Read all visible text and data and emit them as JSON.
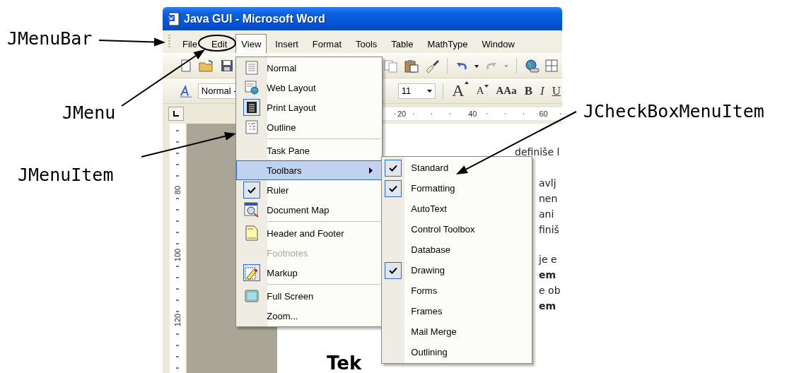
{
  "window": {
    "title": "Java GUI - Microsoft Word"
  },
  "menu_bar": [
    {
      "label": "File",
      "selected": false
    },
    {
      "label": "Edit",
      "selected": false
    },
    {
      "label": "View",
      "selected": true
    },
    {
      "label": "Insert",
      "selected": false
    },
    {
      "label": "Format",
      "selected": false
    },
    {
      "label": "Tools",
      "selected": false
    },
    {
      "label": "Table",
      "selected": false
    },
    {
      "label": "MathType",
      "selected": false
    },
    {
      "label": "Window",
      "selected": false
    }
  ],
  "view_menu": [
    {
      "kind": "item",
      "label": "Normal",
      "checked": false,
      "selected": false,
      "disabled": false,
      "submenu": false
    },
    {
      "kind": "item",
      "label": "Web Layout",
      "checked": false,
      "selected": false,
      "disabled": false,
      "submenu": false
    },
    {
      "kind": "item",
      "label": "Print Layout",
      "checked": true,
      "selected": false,
      "disabled": false,
      "submenu": false
    },
    {
      "kind": "item",
      "label": "Outline",
      "checked": false,
      "selected": false,
      "disabled": false,
      "submenu": false
    },
    {
      "kind": "separator"
    },
    {
      "kind": "item",
      "label": "Task Pane",
      "checked": false,
      "selected": false,
      "disabled": false,
      "submenu": false
    },
    {
      "kind": "item",
      "label": "Toolbars",
      "checked": false,
      "selected": true,
      "disabled": false,
      "submenu": true
    },
    {
      "kind": "item",
      "label": "Ruler",
      "checked": true,
      "selected": false,
      "disabled": false,
      "submenu": false
    },
    {
      "kind": "item",
      "label": "Document Map",
      "checked": false,
      "selected": false,
      "disabled": false,
      "submenu": false
    },
    {
      "kind": "separator"
    },
    {
      "kind": "item",
      "label": "Header and Footer",
      "checked": false,
      "selected": false,
      "disabled": false,
      "submenu": false
    },
    {
      "kind": "item",
      "label": "Footnotes",
      "checked": false,
      "selected": false,
      "disabled": true,
      "submenu": false
    },
    {
      "kind": "item",
      "label": "Markup",
      "checked": true,
      "selected": false,
      "disabled": false,
      "submenu": false
    },
    {
      "kind": "separator"
    },
    {
      "kind": "item",
      "label": "Full Screen",
      "checked": false,
      "selected": false,
      "disabled": false,
      "submenu": false
    },
    {
      "kind": "item",
      "label": "Zoom...",
      "checked": false,
      "selected": false,
      "disabled": false,
      "submenu": false
    }
  ],
  "toolbars_submenu": [
    {
      "label": "Standard",
      "checked": true
    },
    {
      "label": "Formatting",
      "checked": true
    },
    {
      "label": "AutoText",
      "checked": false
    },
    {
      "label": "Control Toolbox",
      "checked": false
    },
    {
      "label": "Database",
      "checked": false
    },
    {
      "label": "Drawing",
      "checked": true
    },
    {
      "label": "Forms",
      "checked": false
    },
    {
      "label": "Frames",
      "checked": false
    },
    {
      "label": "Mail Merge",
      "checked": false
    },
    {
      "label": "Outlining",
      "checked": false
    }
  ],
  "formatting_toolbar": {
    "style": "Normal -",
    "font_size": "11",
    "buttons": [
      {
        "kind": "grow",
        "label": "A"
      },
      {
        "kind": "shrink",
        "label": "A"
      },
      {
        "kind": "case",
        "label": "AAa"
      },
      {
        "kind": "bold",
        "label": "B"
      },
      {
        "kind": "italic",
        "label": "I"
      },
      {
        "kind": "underline",
        "label": "U"
      }
    ]
  },
  "horizontal_ruler": [
    "20",
    "40",
    "60"
  ],
  "vertical_ruler": [
    "80",
    "100",
    "120"
  ],
  "document": {
    "top_line": "definiše l",
    "paragraphs": [
      [
        {
          "text": "avlj",
          "bold": false
        },
        {
          "text": "nen",
          "bold": false
        },
        {
          "text": "ani",
          "bold": false
        },
        {
          "text": "finiš",
          "bold": false
        }
      ],
      [
        {
          "text": "je e",
          "bold": false
        },
        {
          "text": "em",
          "bold": true
        },
        {
          "text": "e ob",
          "bold": false
        },
        {
          "text": "em",
          "bold": true
        }
      ]
    ],
    "heading": "Tek"
  },
  "annotations": [
    {
      "label": "JMenuBar"
    },
    {
      "label": "JMenu"
    },
    {
      "label": "JMenuItem"
    },
    {
      "label": "JCheckBoxMenuItem"
    }
  ]
}
